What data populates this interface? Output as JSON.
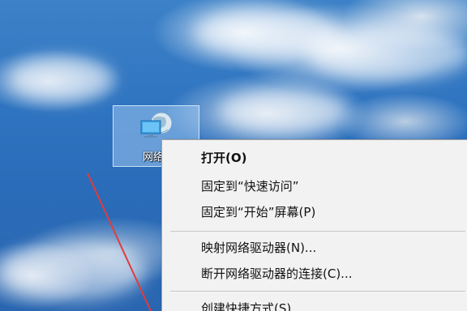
{
  "desktop": {
    "icon": {
      "label": "网络",
      "icon_name": "network-icon",
      "selected": true
    }
  },
  "context_menu": {
    "items": [
      {
        "label": "打开(O)",
        "bold": true
      },
      {
        "label": "固定到“快速访问”"
      },
      {
        "label": "固定到“开始”屏幕(P)"
      },
      {
        "label": "映射网络驱动器(N)..."
      },
      {
        "label": "断开网络驱动器的连接(C)..."
      },
      {
        "label": "创建快捷方式(S)"
      }
    ]
  },
  "colors": {
    "menu_background": "#f2f2f2",
    "menu_border": "#a0a0a0",
    "selection_tile": "#b4d7fa",
    "annotation_line": "#e23b3b"
  }
}
